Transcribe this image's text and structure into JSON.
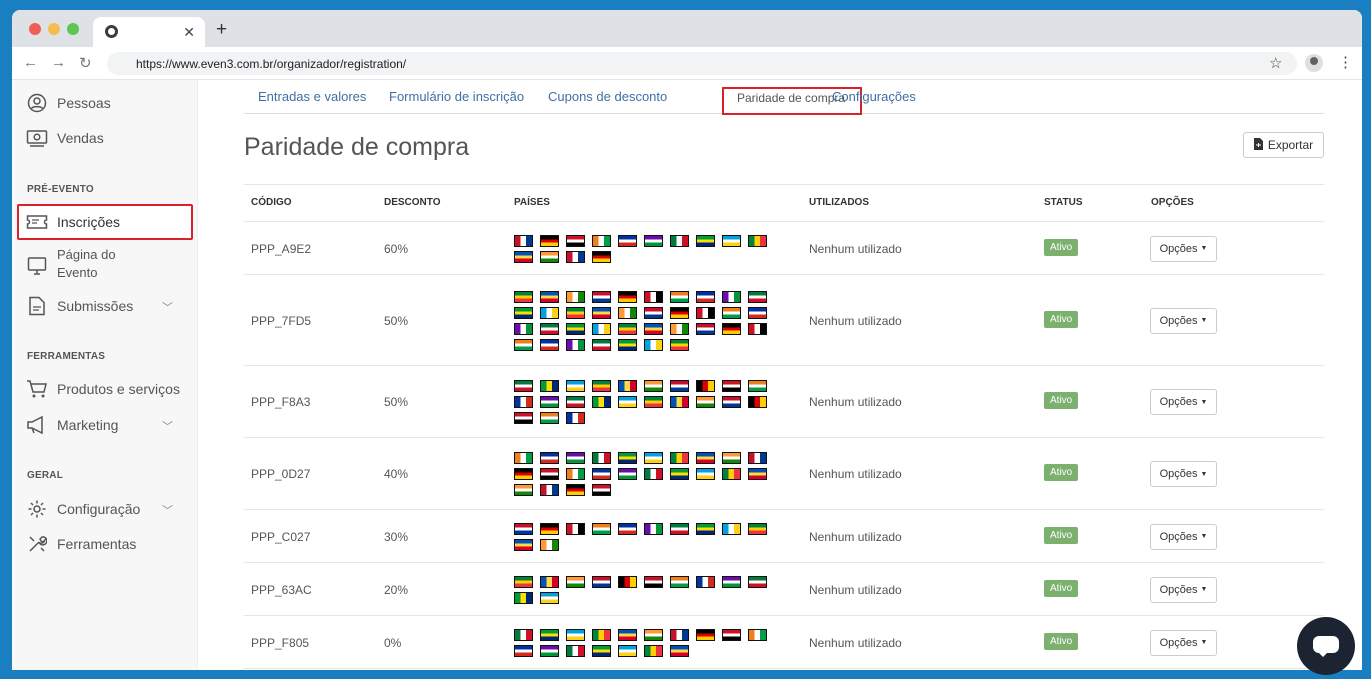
{
  "browser": {
    "url": "https://www.even3.com.br/organizador/registration/"
  },
  "sidebar": {
    "items_top": [
      {
        "label": "Pessoas",
        "icon": "user-circle-icon"
      },
      {
        "label": "Vendas",
        "icon": "money-icon"
      }
    ],
    "section_pre": "PRÉ-EVENTO",
    "inscricoes": "Inscrições",
    "pagina_line1": "Página do",
    "pagina_line2": "Evento",
    "submissoes": "Submissões",
    "section_tools": "FERRAMENTAS",
    "produtos": "Produtos e serviços",
    "marketing": "Marketing",
    "section_general": "GERAL",
    "configuracao": "Configuração",
    "ferramentas": "Ferramentas"
  },
  "subnav": {
    "tabs": [
      "Entradas e valores",
      "Formulário de inscrição",
      "Cupons de desconto",
      "Paridade de compra",
      "Configurações"
    ],
    "active": "Paridade de compra"
  },
  "page": {
    "title": "Paridade de compra",
    "export_label": "Exportar"
  },
  "table": {
    "headers": [
      "CÓDIGO",
      "DESCONTO",
      "PAÍSES",
      "UTILIZADOS",
      "STATUS",
      "OPÇÕES"
    ],
    "rows": [
      {
        "code": "PPP_A9E2",
        "discount": "60%",
        "used": "Nenhum utilizado",
        "status": "Ativo",
        "options": "Opções",
        "flag_count": 14
      },
      {
        "code": "PPP_7FD5",
        "discount": "50%",
        "used": "Nenhum utilizado",
        "status": "Ativo",
        "options": "Opções",
        "flag_count": 37
      },
      {
        "code": "PPP_F8A3",
        "discount": "50%",
        "used": "Nenhum utilizado",
        "status": "Ativo",
        "options": "Opções",
        "flag_count": 23
      },
      {
        "code": "PPP_0D27",
        "discount": "40%",
        "used": "Nenhum utilizado",
        "status": "Ativo",
        "options": "Opções",
        "flag_count": 24
      },
      {
        "code": "PPP_C027",
        "discount": "30%",
        "used": "Nenhum utilizado",
        "status": "Ativo",
        "options": "Opções",
        "flag_count": 12
      },
      {
        "code": "PPP_63AC",
        "discount": "20%",
        "used": "Nenhum utilizado",
        "status": "Ativo",
        "options": "Opções",
        "flag_count": 12
      },
      {
        "code": "PPP_F805",
        "discount": "0%",
        "used": "Nenhum utilizado",
        "status": "Ativo",
        "options": "Opções",
        "flag_count": 17
      }
    ]
  },
  "colors": {
    "accent": "#3f6fa3",
    "highlight": "#d9232a",
    "status_green": "#7bb06f",
    "frame": "#1a7fc1"
  }
}
